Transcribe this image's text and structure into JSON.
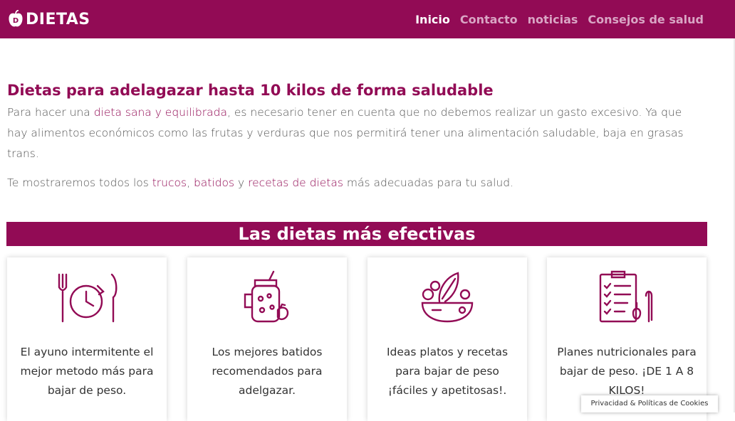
{
  "nav": {
    "brand": "DIETAS",
    "links": [
      {
        "label": "Inicio",
        "active": true
      },
      {
        "label": "Contacto",
        "active": false
      },
      {
        "label": "noticias",
        "active": false
      },
      {
        "label": "Consejos de salud",
        "active": false
      }
    ]
  },
  "intro": {
    "title": "Dietas para adelagazar hasta 10 kilos de forma saludable",
    "p1_a": "Para hacer una ",
    "p1_link": "dieta sana y equilibrada",
    "p1_b": ", es necesario tener en cuenta que no debemos realizar un gasto excesivo. Ya que hay alimentos económicos como las frutas y verduras que nos permitirá tener una alimentación saludable, baja en grasas trans.",
    "p2_a": "Te mostraremos todos los ",
    "p2_link1": "trucos",
    "p2_sep1": ", ",
    "p2_link2": "batidos",
    "p2_sep2": " y ",
    "p2_link3": "recetas de dietas",
    "p2_b": " más adecuadas para tu salud."
  },
  "section": {
    "title": "Las dietas más efectivas"
  },
  "cards": [
    {
      "icon": "clock-cutlery-icon",
      "text": "El ayuno intermitente el mejor metodo más para bajar de peso."
    },
    {
      "icon": "smoothie-jar-icon",
      "text": "Los mejores batidos recomendados para adelgazar."
    },
    {
      "icon": "salad-bowl-icon",
      "text": "Ideas platos y recetas para bajar de peso ¡fáciles y apetitosas!."
    },
    {
      "icon": "nutrition-plan-icon",
      "text": "Planes nutricionales para bajar de peso. ¡DE 1 A 8 KILOS!"
    }
  ],
  "cookie": {
    "label": "Privacidad & Políticas de Cookies"
  },
  "colors": {
    "brand": "#920b55",
    "nav_inactive": "#d9a5c4"
  }
}
